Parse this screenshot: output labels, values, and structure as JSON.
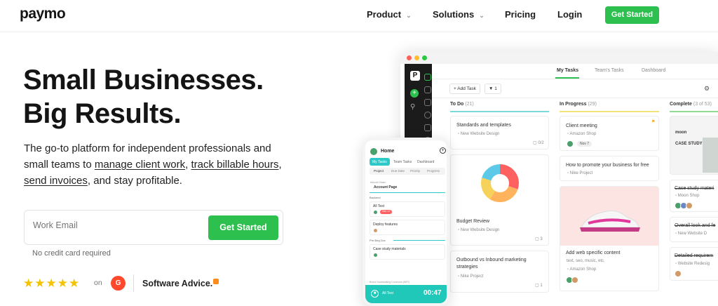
{
  "header": {
    "logo": "paymo",
    "nav": [
      {
        "label": "Product",
        "dropdown": true
      },
      {
        "label": "Solutions",
        "dropdown": true
      },
      {
        "label": "Pricing",
        "dropdown": false
      },
      {
        "label": "Login",
        "dropdown": false
      }
    ],
    "cta": "Get Started"
  },
  "hero": {
    "title_line1": "Small Businesses.",
    "title_line2": "Big Results.",
    "subtitle_start": "The go-to platform for independent professionals and small teams to",
    "link_manage": "manage client work",
    "link_track": "track billable hours",
    "link_invoices": "send invoices",
    "subtitle_end": ", and stay profitable.",
    "email_placeholder": "Work Email",
    "cta": "Get Started",
    "note": "No credit card required",
    "rating_stars": 5,
    "on_text": "on",
    "g2": "G",
    "software_advice": "Software Advice."
  },
  "colors": {
    "brand_green": "#2ec04f",
    "teal": "#1fc8b8"
  },
  "app": {
    "tabs": [
      "My Tasks",
      "Team's Tasks",
      "Dashboard"
    ],
    "toolbar": {
      "add_task": "+ Add Task",
      "filter_count": "1"
    },
    "columns": [
      {
        "title": "To Do",
        "count": "(21)",
        "color": "#7fd8d8"
      },
      {
        "title": "In Progress",
        "count": "(29)",
        "color": "#f2e27a"
      },
      {
        "title": "Complete",
        "count": "(3 of 53)",
        "color": "#8fdc8f"
      }
    ],
    "todo": [
      {
        "title": "Standards and templates",
        "project": "New Website Design",
        "meta": "0/2"
      },
      {
        "title": "Budget Review",
        "project": "New Website Design",
        "meta": "3"
      },
      {
        "title": "Outbound vs Inbound marketing strategies",
        "project": "Nike Project",
        "meta": "1"
      }
    ],
    "progress": [
      {
        "title": "Client meeting",
        "project": "Amazon Shop",
        "pill": "Nov 7"
      },
      {
        "title": "How to promote your business for free",
        "project": "Nike Project"
      },
      {
        "title": "Add web specific content",
        "tags": "text, seo, music, etc.",
        "project": "Amazon Shop"
      }
    ],
    "complete": [
      {
        "title": "moon",
        "subtitle": "CASE STUDY"
      },
      {
        "title": "Case study materi",
        "project": "Moon Shop"
      },
      {
        "title": "Overall look and fe",
        "project": "New Website D"
      },
      {
        "title": "Detailed requirem",
        "project": "Website Redesig"
      }
    ]
  },
  "phone": {
    "title": "Home",
    "tabs": [
      "My Tasks",
      "Team Tasks",
      "Dashboard"
    ],
    "segments": [
      "Project",
      "Due Date",
      "Priority",
      "Progress"
    ],
    "project_caption": "Marvel Brain",
    "project_title": "Account Page",
    "section1": "Backend",
    "rows": [
      {
        "title": "All Test",
        "pill": "Dec 14"
      },
      {
        "title": "Deploy features",
        "pill": ""
      }
    ],
    "section2": "Pre-Beg Doc",
    "row3": "Case study materials",
    "footer_caption": "Brand Sandwalking Commons (BRT)",
    "timer_label": "All Test",
    "timer": "00:47"
  }
}
